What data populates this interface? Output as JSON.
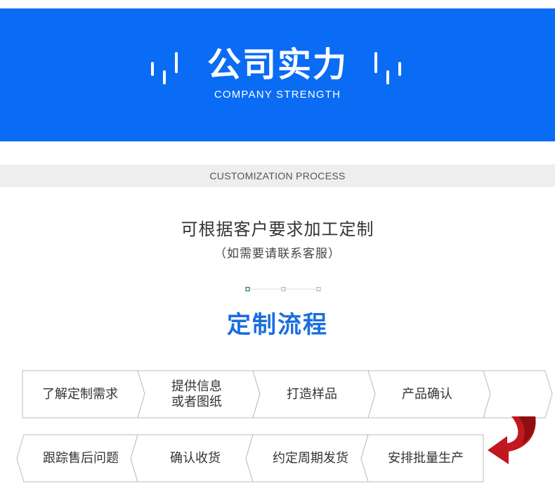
{
  "banner": {
    "title": "公司实力",
    "subtitle": "COMPANY STRENGTH",
    "background_color": "#0a6cf5"
  },
  "section_strip": {
    "label": "CUSTOMIZATION PROCESS"
  },
  "intro": {
    "line1": "可根据客户要求加工定制",
    "line2": "（如需要请联系客服）"
  },
  "process": {
    "title": "定制流程",
    "title_color": "#1a6ee0",
    "row1": [
      {
        "label": "了解定制需求"
      },
      {
        "label_line1": "提供信息",
        "label_line2": "或者图纸"
      },
      {
        "label": "打造样品"
      },
      {
        "label": "产品确认"
      },
      {
        "label": ""
      }
    ],
    "row2": [
      {
        "label": "跟踪售后问题"
      },
      {
        "label": "确认收货"
      },
      {
        "label": "约定周期发货"
      },
      {
        "label": "安排批量生产"
      }
    ],
    "turn_arrow_color": "#c0181e"
  }
}
